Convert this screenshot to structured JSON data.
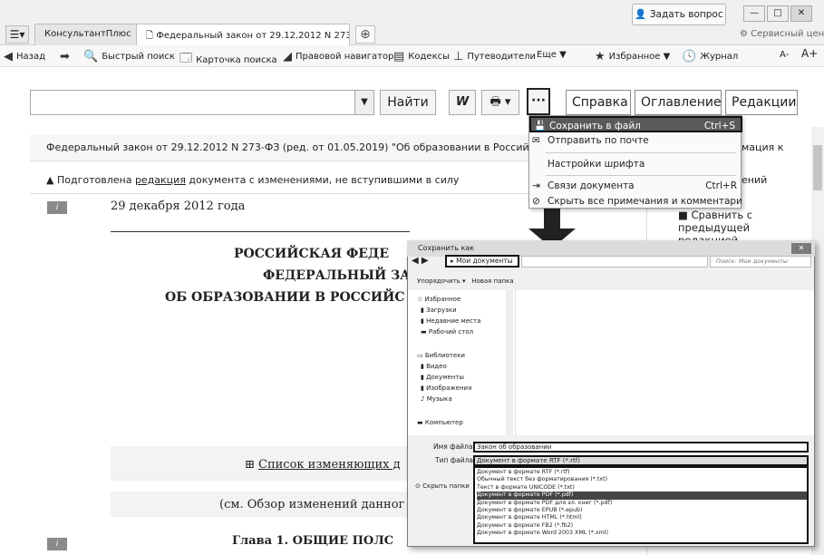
{
  "app": {
    "brand_tab": "КонсультантПлюс",
    "doc_tab": "Федеральный закон от 29.12.2012 N 273",
    "ask_button": "Задать вопрос",
    "service_center": "Сервисный центр"
  },
  "toolbar": {
    "back": "Назад",
    "quick_search": "Быстрый поиск",
    "search_card": "Карточка поиска",
    "legal_navigator": "Правовой навигатор",
    "codes": "Кодексы",
    "guides": "Путеводители",
    "more": "Еще ▼",
    "favorites": "Избранное ▼",
    "journal": "Журнал",
    "font_smaller": "A-",
    "font_larger": "A+"
  },
  "search": {
    "value": "",
    "find_button": "Найти"
  },
  "nav_buttons": {
    "more": "···",
    "help": "Справка",
    "contents": "Оглавление",
    "editions": "Редакции"
  },
  "document": {
    "header": "Федеральный закон от 29.12.2012 N 273-ФЗ (ред. от 01.05.2019) \"Об образовании в Российской Федерации\"",
    "warning_prefix": "Подготовлена ",
    "warning_link": "редакция",
    "warning_suffix": " документа с изменениями, не вступившими в силу",
    "date": "29 декабря 2012 года",
    "title1": "РОССИЙСКАЯ ФЕДЕ",
    "title2": "ФЕДЕРАЛЬНЫЙ ЗА",
    "title3": "ОБ ОБРАЗОВАНИИ В РОССИЙС",
    "changes_list": "Список изменяющих д",
    "review": "(см. Обзор изменений данног",
    "chapter1": "Глава 1. ОБЩИЕ ПОЛС"
  },
  "sidebar": {
    "info": "мация к",
    "changes": "ений",
    "compare": "Сравнить с предыдущей редакцией"
  },
  "menu": {
    "items": [
      {
        "label": "Сохранить в файл",
        "shortcut": "Ctrl+S"
      },
      {
        "label": "Отправить по почте",
        "shortcut": ""
      },
      {
        "label": "Настройки шрифта",
        "shortcut": ""
      },
      {
        "label": "Связи документа",
        "shortcut": "Ctrl+R"
      },
      {
        "label": "Скрыть все примечания и комментарии",
        "shortcut": ""
      }
    ]
  },
  "save_dialog": {
    "title": "Сохранить как",
    "path": "▸ Мои документы",
    "search_placeholder": "Поиск: Мои документы",
    "organize": "Упорядочить ▾",
    "new_folder": "Новая папка",
    "tree": [
      "Избранное",
      "Загрузки",
      "Недавние места",
      "Рабочий стол",
      "Библиотеки",
      "Видео",
      "Документы",
      "Изображения",
      "Музыка",
      "Компьютер"
    ],
    "filename_label": "Имя файла:",
    "filename": "Закон об образовании",
    "filetype_label": "Тип файла:",
    "filetype": "Документ в формате RTF (*.rtf)",
    "filetypes": [
      "Документ в формате RTF (*.rtf)",
      "Обычный текст без форматирования (*.txt)",
      "Текст в формате UNICODE (*.txt)",
      "Документ в формате PDF (*.pdf)",
      "Документ в формате PDF для эл. книг (*.pdf)",
      "Документ в формате EPUB (*.epub)",
      "Документ в формате HTML (*.html)",
      "Документ в формате FB2 (*.fb2)",
      "Документ в формате Word 2003 XML (*.xml)"
    ],
    "hide_folders": "Скрыть папки"
  }
}
